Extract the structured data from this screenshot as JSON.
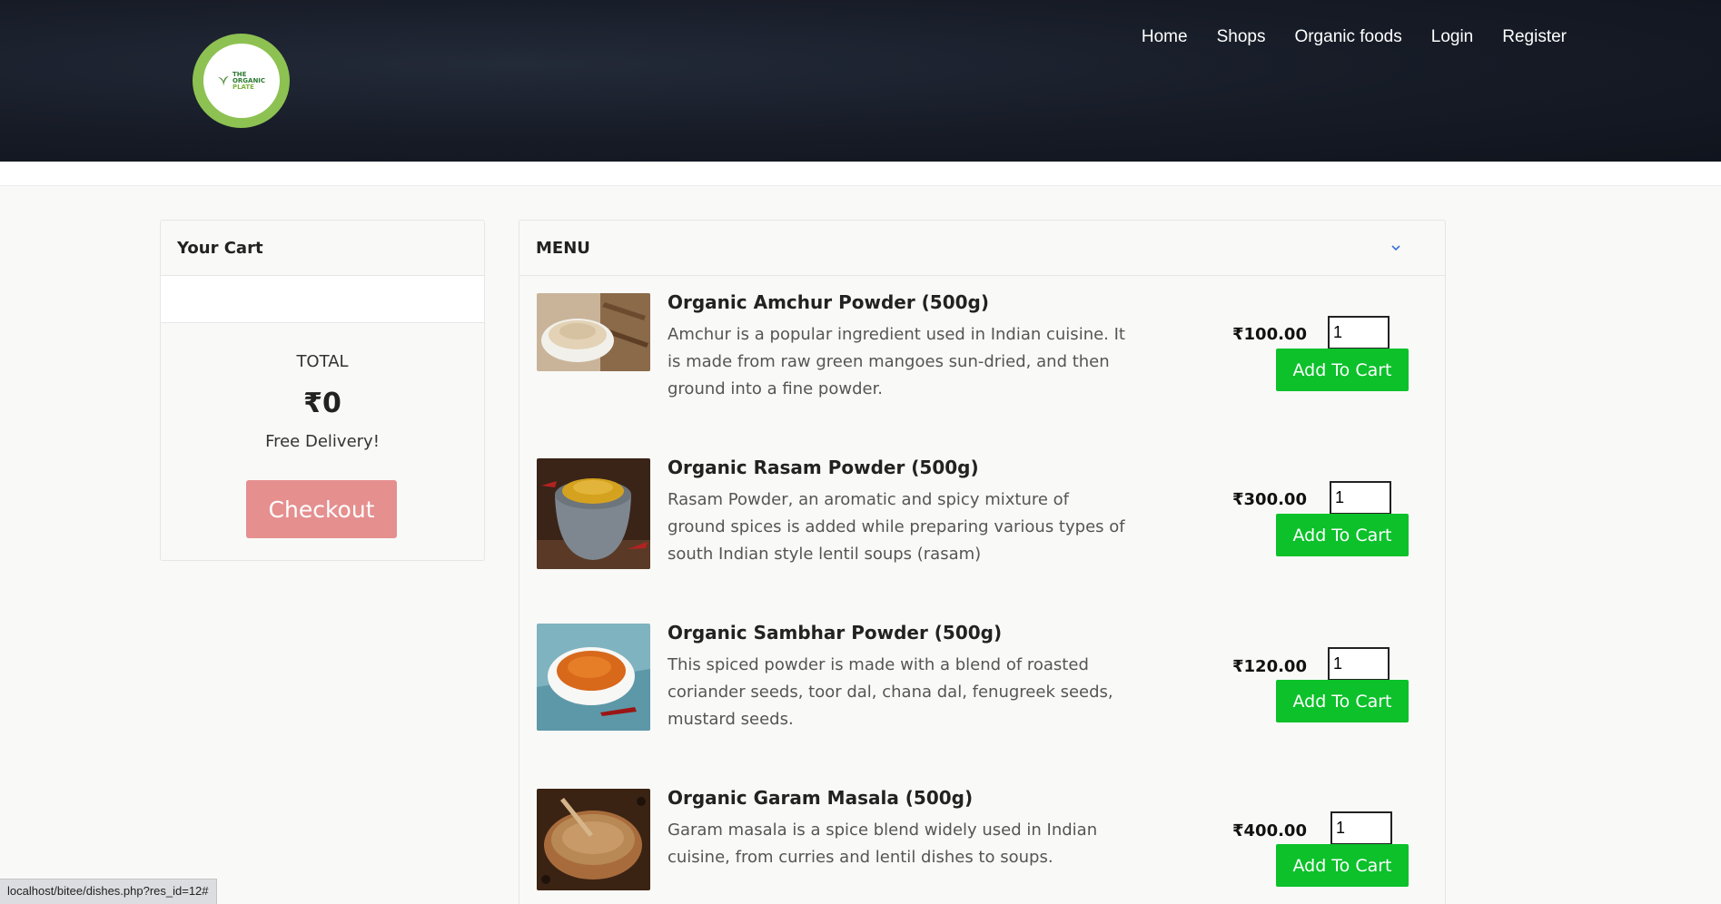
{
  "header": {
    "logo": {
      "line1": "THE",
      "line2": "ORGANIC",
      "line3": "PLATE"
    },
    "nav": [
      "Home",
      "Shops",
      "Organic foods",
      "Login",
      "Register"
    ]
  },
  "cart": {
    "title": "Your Cart",
    "total_label": "TOTAL",
    "total_value": "₹0",
    "delivery": "Free Delivery!",
    "checkout_label": "Checkout"
  },
  "menu": {
    "title": "MENU",
    "items": [
      {
        "title": "Organic Amchur Powder (500g)",
        "desc": "Amchur is a popular ingredient used in Indian cuisine. It is made from raw green mangoes sun-dried, and then ground into a fine powder.",
        "price": "₹100.00",
        "qty": "1",
        "button": "Add To Cart"
      },
      {
        "title": "Organic Rasam Powder (500g)",
        "desc": "Rasam Powder, an aromatic and spicy mixture of ground spices is added while preparing various types of south Indian style lentil soups (rasam)",
        "price": "₹300.00",
        "qty": "1",
        "button": "Add To Cart"
      },
      {
        "title": "Organic Sambhar Powder (500g)",
        "desc": "This spiced powder is made with a blend of roasted coriander seeds, toor dal, chana dal, fenugreek seeds, mustard seeds.",
        "price": "₹120.00",
        "qty": "1",
        "button": "Add To Cart"
      },
      {
        "title": "Organic Garam Masala (500g)",
        "desc": "Garam masala is a spice blend widely used in Indian cuisine, from curries and lentil dishes to soups.",
        "price": "₹400.00",
        "qty": "1",
        "button": "Add To Cart"
      }
    ]
  },
  "status_bar": "localhost/bitee/dishes.php?res_id=12#",
  "colors": {
    "header_bg": "#161b26",
    "add_button": "#0cc12a",
    "checkout": "#e58f8f",
    "logo_ring": "#8dc152"
  }
}
